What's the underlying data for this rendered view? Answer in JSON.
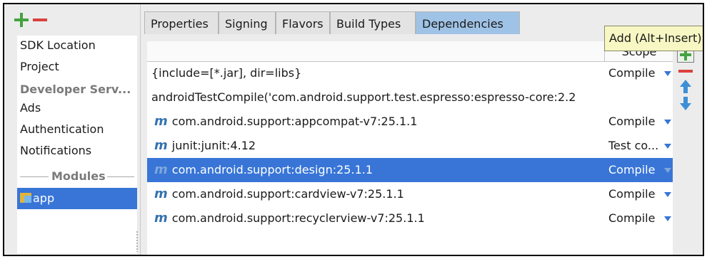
{
  "left_panel": {
    "items": [
      "SDK Location",
      "Project",
      "Developer Serv...",
      "Ads",
      "Authentication",
      "Notifications"
    ],
    "modules_label": "Modules",
    "modules": [
      "app"
    ]
  },
  "tabs": [
    "Properties",
    "Signing",
    "Flavors",
    "Build Types",
    "Dependencies"
  ],
  "active_tab": "Dependencies",
  "table": {
    "scope_header": "Scope",
    "rows": [
      {
        "dependency": "{include=[*.jar], dir=libs}",
        "scope": "Compile"
      },
      {
        "dependency": "androidTestCompile('com.android.support.test.espresso:espresso-core:2.2",
        "scope": ""
      },
      {
        "dependency": "com.android.support:appcompat-v7:25.1.1",
        "scope": "Compile"
      },
      {
        "dependency": "junit:junit:4.12",
        "scope": "Test co..."
      },
      {
        "dependency": "com.android.support:design:25.1.1",
        "scope": "Compile"
      },
      {
        "dependency": "com.android.support:cardview-v7:25.1.1",
        "scope": "Compile"
      },
      {
        "dependency": "com.android.support:recyclerview-v7:25.1.1",
        "scope": "Compile"
      }
    ],
    "maven_icon": "m",
    "selected_row": 4
  },
  "tooltip": "Add (Alt+Insert)",
  "icons": [
    "add-icon",
    "remove-icon",
    "move-up-icon",
    "move-down-icon",
    "maven-icon",
    "module-folder-icon"
  ],
  "colors": {
    "selection": "#3875d7",
    "active_tab": "#9fc3e6",
    "add": "#45a340",
    "remove": "#d9413c"
  }
}
